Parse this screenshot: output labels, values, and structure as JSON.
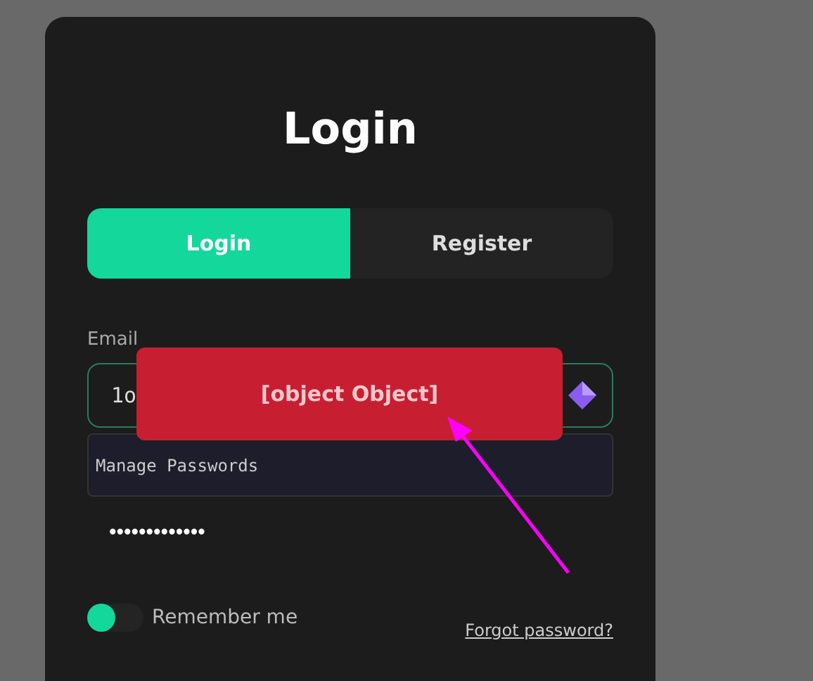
{
  "title": "Login",
  "tabs": [
    {
      "label": "Login",
      "selected": true
    },
    {
      "label": "Register",
      "selected": false
    }
  ],
  "email": {
    "label": "Email",
    "value": "1o"
  },
  "autofill_menu": {
    "items": [
      "Manage Passwords"
    ]
  },
  "password": {
    "value": "•••••••••••••"
  },
  "remember": {
    "label": "Remember me",
    "on": false
  },
  "forgot_link": "Forgot password?",
  "toast": {
    "message": "[object Object]"
  }
}
